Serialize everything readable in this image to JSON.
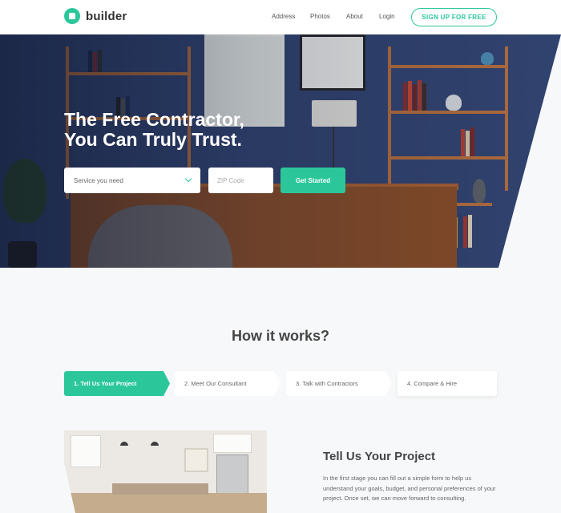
{
  "header": {
    "logo_text": "builder",
    "nav": [
      {
        "label": "Address"
      },
      {
        "label": "Photos"
      },
      {
        "label": "About"
      },
      {
        "label": "Login"
      }
    ],
    "signup_label": "SIGN UP FOR FREE"
  },
  "hero": {
    "title_line1": "The Free Contractor,",
    "title_line2": "You Can Truly Trust.",
    "service_select_value": "Service you need",
    "zip_placeholder": "ZIP Code",
    "cta_label": "Get Started"
  },
  "how_it_works": {
    "title": "How it works?",
    "steps": [
      {
        "label": "1. Tell Us Your Project",
        "active": true
      },
      {
        "label": "2. Meet Our Consultant",
        "active": false
      },
      {
        "label": "3. Talk with Contractors",
        "active": false
      },
      {
        "label": "4. Compare & Hire",
        "active": false
      }
    ]
  },
  "content": {
    "title": "Tell Us Your Project",
    "body": "In the first stage you can fill out a simple form to help us understand your goals, budget, and personal preferences of your project. Once set, we can move forward to consulting."
  },
  "colors": {
    "accent": "#2bc79b",
    "hero_background": "#31436f",
    "page_background": "#f7f8f9"
  },
  "icons": [
    "logo-house-icon",
    "chevron-down-icon"
  ]
}
